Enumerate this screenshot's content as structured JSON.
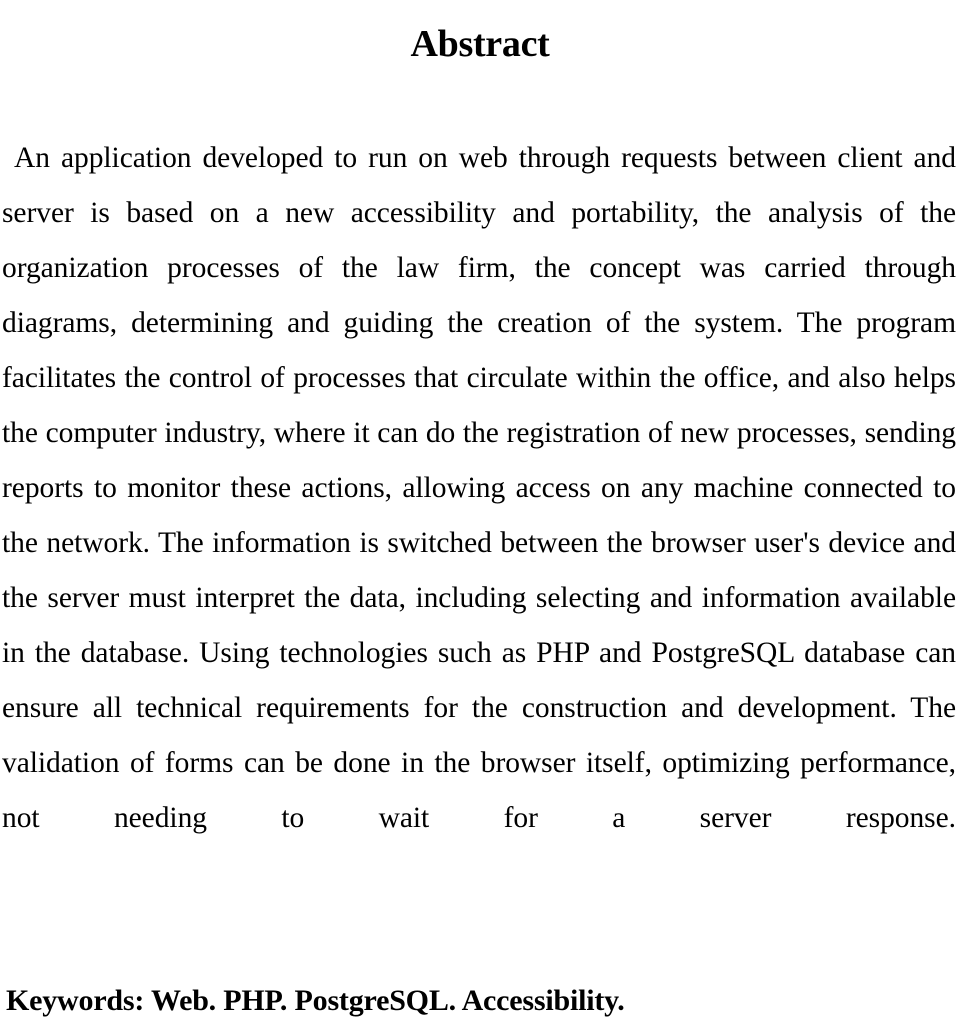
{
  "document": {
    "section_heading": "Abstract",
    "abstract_text": "An application developed to run on web through requests between client and server is based on a new accessibility and portability, the analysis of the organization processes of the law firm, the concept was carried through diagrams, determining and guiding the creation of the system. The program facilitates the control of processes that circulate within the office, and also helps the computer industry, where it can do the registration of new processes, sending reports to monitor these actions, allowing access on any machine connected to the network. The information is switched between the browser user's device and the server must interpret the data, including selecting and information available in the database. Using technologies such as PHP and PostgreSQL database can ensure all technical requirements for the construction and development. The validation of forms can be done in the browser itself, optimizing performance, not needing to wait for a server response.",
    "abstract_lines": [
      "An application developed to run on web through requests between client",
      "and server is based on a new accessibility and portability, the analysis of",
      "the organization processes of the law firm, the concept was carried",
      "through diagrams, determining and guiding the creation of the system.",
      "The program facilitates the control of processes that circulate within the",
      "office, and also helps the computer industry, where it can do the",
      "registration of new processes, sending reports to monitor these actions,",
      "allowing access on any machine connected to the network. The",
      "information is switched between the browser user's device and the server",
      "must interpret the data, including selecting and information available in",
      "the database. Using technologies such as PHP and PostgreSQL database",
      "can ensure all technical requirements for the construction and",
      "development. The validation of forms can be done in the browser itself,",
      "optimizing performance, not needing to wait for a server response."
    ],
    "keywords_line": "Keywords: Web. PHP. PostgreSQL. Accessibility.",
    "keywords_label": "Keywords:",
    "keywords": [
      "Web.",
      "PHP.",
      "PostgreSQL.",
      "Accessibility."
    ],
    "colors": {
      "page_background": "#ffffff",
      "text": "#000000"
    }
  }
}
